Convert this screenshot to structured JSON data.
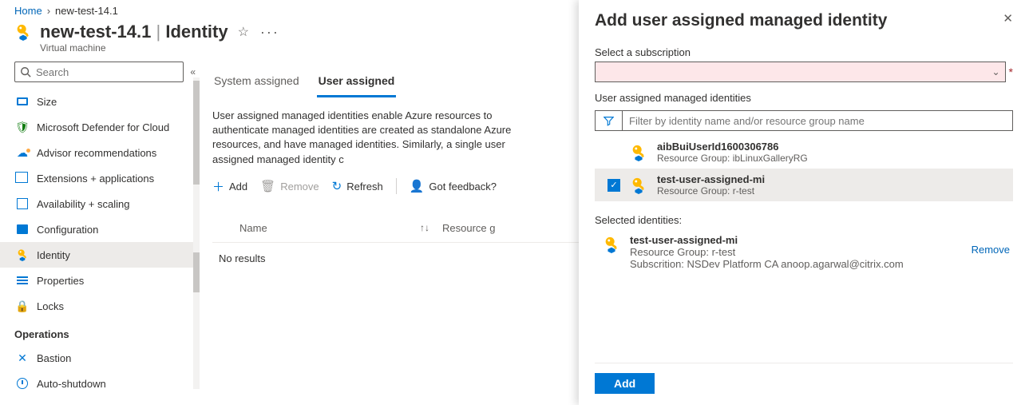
{
  "breadcrumb": {
    "home": "Home",
    "current": "new-test-14.1"
  },
  "header": {
    "resource_name": "new-test-14.1",
    "section": "Identity",
    "subtitle": "Virtual machine"
  },
  "sidebar": {
    "search_placeholder": "Search",
    "items": [
      {
        "label": "Size"
      },
      {
        "label": "Microsoft Defender for Cloud"
      },
      {
        "label": "Advisor recommendations"
      },
      {
        "label": "Extensions + applications"
      },
      {
        "label": "Availability + scaling"
      },
      {
        "label": "Configuration"
      },
      {
        "label": "Identity"
      },
      {
        "label": "Properties"
      },
      {
        "label": "Locks"
      }
    ],
    "section_operations": "Operations",
    "ops": [
      {
        "label": "Bastion"
      },
      {
        "label": "Auto-shutdown"
      }
    ]
  },
  "tabs": {
    "system": "System assigned",
    "user": "User assigned"
  },
  "description": "User assigned managed identities enable Azure resources to authenticate managed identities are created as standalone Azure resources, and have managed identities. Similarly, a single user assigned managed identity c",
  "toolbar": {
    "add": "Add",
    "remove": "Remove",
    "refresh": "Refresh",
    "feedback": "Got feedback?"
  },
  "table": {
    "col_name": "Name",
    "col_rg": "Resource g",
    "no_results": "No results"
  },
  "panel": {
    "title": "Add user assigned managed identity",
    "select_sub_label": "Select a subscription",
    "uami_label": "User assigned managed identities",
    "filter_placeholder": "Filter by identity name and/or resource group name",
    "identities": [
      {
        "name": "aibBuiUserId1600306786",
        "rg": "Resource Group: ibLinuxGalleryRG",
        "selected": false
      },
      {
        "name": "test-user-assigned-mi",
        "rg": "Resource Group: r-test",
        "selected": true
      }
    ],
    "selected_header": "Selected identities:",
    "selected": {
      "name": "test-user-assigned-mi",
      "rg": "Resource Group: r-test",
      "sub": "Subscrition: NSDev Platform CA anoop.agarwal@citrix.com",
      "remove": "Remove"
    },
    "add_button": "Add"
  }
}
